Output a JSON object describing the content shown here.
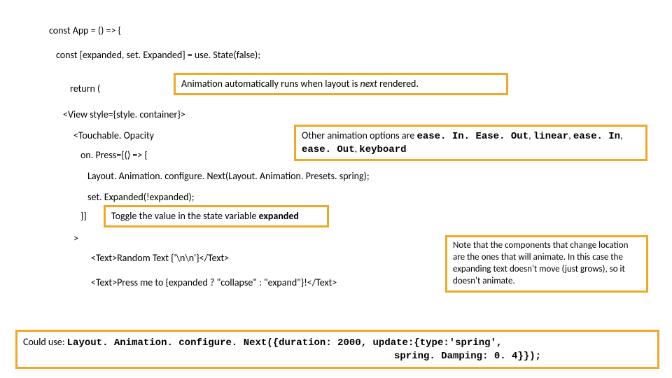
{
  "code": {
    "l1": "const App = () => {",
    "l2": "const [expanded, set. Expanded] = use. State(false);",
    "l3": "return (",
    "l4": "<View style={style. container}>",
    "l5": "<Touchable. Opacity",
    "l6": "on. Press={() => {",
    "l7": "Layout. Animation. configure. Next(Layout. Animation. Presets. spring);",
    "l8": "set. Expanded(!expanded);",
    "l9": "}}",
    "l10": ">",
    "l11": "<Text>Random Text {'\\n\\n'}</Text>",
    "l12": "<Text>Press me to {expanded ? \"collapse\" : \"expand\"}!</Text>"
  },
  "callouts": {
    "auto_animation": {
      "pre": "Animation automatically runs when layout is ",
      "italic": "next",
      "post": " rendered."
    },
    "options": {
      "pre": "Other animation options are ",
      "opt1": "ease. In. Ease. Out",
      "sep1": ", ",
      "opt2": "linear",
      "sep2": ", ",
      "opt3": "ease. In",
      "sep3": ", ",
      "opt4": "ease. Out",
      "sep4": ", ",
      "opt5": "keyboard"
    },
    "toggle": {
      "pre": "Toggle the value in the state variable ",
      "bold": "expanded"
    },
    "note": "Note that the components that change location are the ones that will animate.  In this case the expanding text doesn't move (just grows), so it doesn't animate.",
    "could_use": {
      "l1_pre": "Could use: ",
      "l1_code": "Layout. Animation. configure. Next({duration: 2000,  update:{type:'spring',",
      "l2_code": "spring. Damping: 0. 4}});"
    }
  }
}
